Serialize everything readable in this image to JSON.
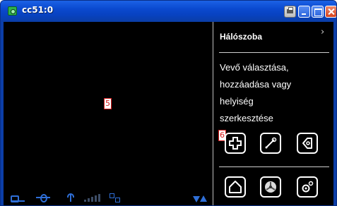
{
  "window": {
    "title": "cc51:0",
    "buttons": [
      "print-icon",
      "minimize-icon",
      "maximize-icon",
      "close-icon"
    ]
  },
  "video": {
    "marker_label": "5",
    "status_icons": [
      "plug-icon",
      "network-icon",
      "antenna-icon",
      "signal-bars-icon",
      "topology-icon"
    ],
    "scroll_icons": [
      "scroll-down-icon",
      "scroll-up-icon"
    ]
  },
  "panel": {
    "title": "Hálószoba",
    "description_lines": [
      "Vevő választása,",
      "hozzáadása vagy",
      "helyiség",
      "szerkesztése"
    ],
    "marker_label": "6",
    "actions_top": [
      {
        "name": "add-icon"
      },
      {
        "name": "wrench-icon"
      },
      {
        "name": "back-icon"
      }
    ],
    "actions_bottom": [
      {
        "name": "home-icon"
      },
      {
        "name": "fan-icon"
      },
      {
        "name": "settings-icon"
      }
    ]
  },
  "colors": {
    "title_bar": "#0a49cf",
    "close_button": "#d6431d",
    "status_blue": "#2f6fd8",
    "marker_red": "#d61b1b"
  }
}
